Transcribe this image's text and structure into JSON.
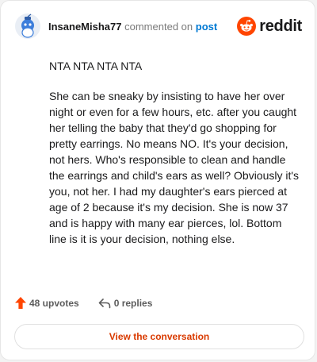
{
  "header": {
    "username": "InsaneMisha77",
    "action_text": "commented on",
    "post_link": "post"
  },
  "brand": {
    "logo_text": "reddit",
    "accent_color": "#ff4500"
  },
  "comment": {
    "paragraphs": [
      "NTA NTA NTA NTA",
      "She can be sneaky by insisting to have her over night or even for a few hours, etc. after you caught her telling the baby that they'd go shopping for pretty earrings. No means NO. It's your decision, not hers. Who's responsible to clean and handle the earrings and child's ears as well? Obviously it's you, not her. I had my daughter's ears pierced at age of 2 because it's my decision. She is now 37 and is happy with many ear pierces, lol. Bottom line is it is your decision, nothing else."
    ]
  },
  "actions": {
    "upvotes": "48 upvotes",
    "replies": "0 replies"
  },
  "cta": {
    "label": "View the conversation"
  },
  "icons": {
    "avatar": "snoo-avatar",
    "logo": "reddit-snoo-icon",
    "upvote": "upvote-arrow-icon",
    "reply": "reply-arrow-icon"
  }
}
